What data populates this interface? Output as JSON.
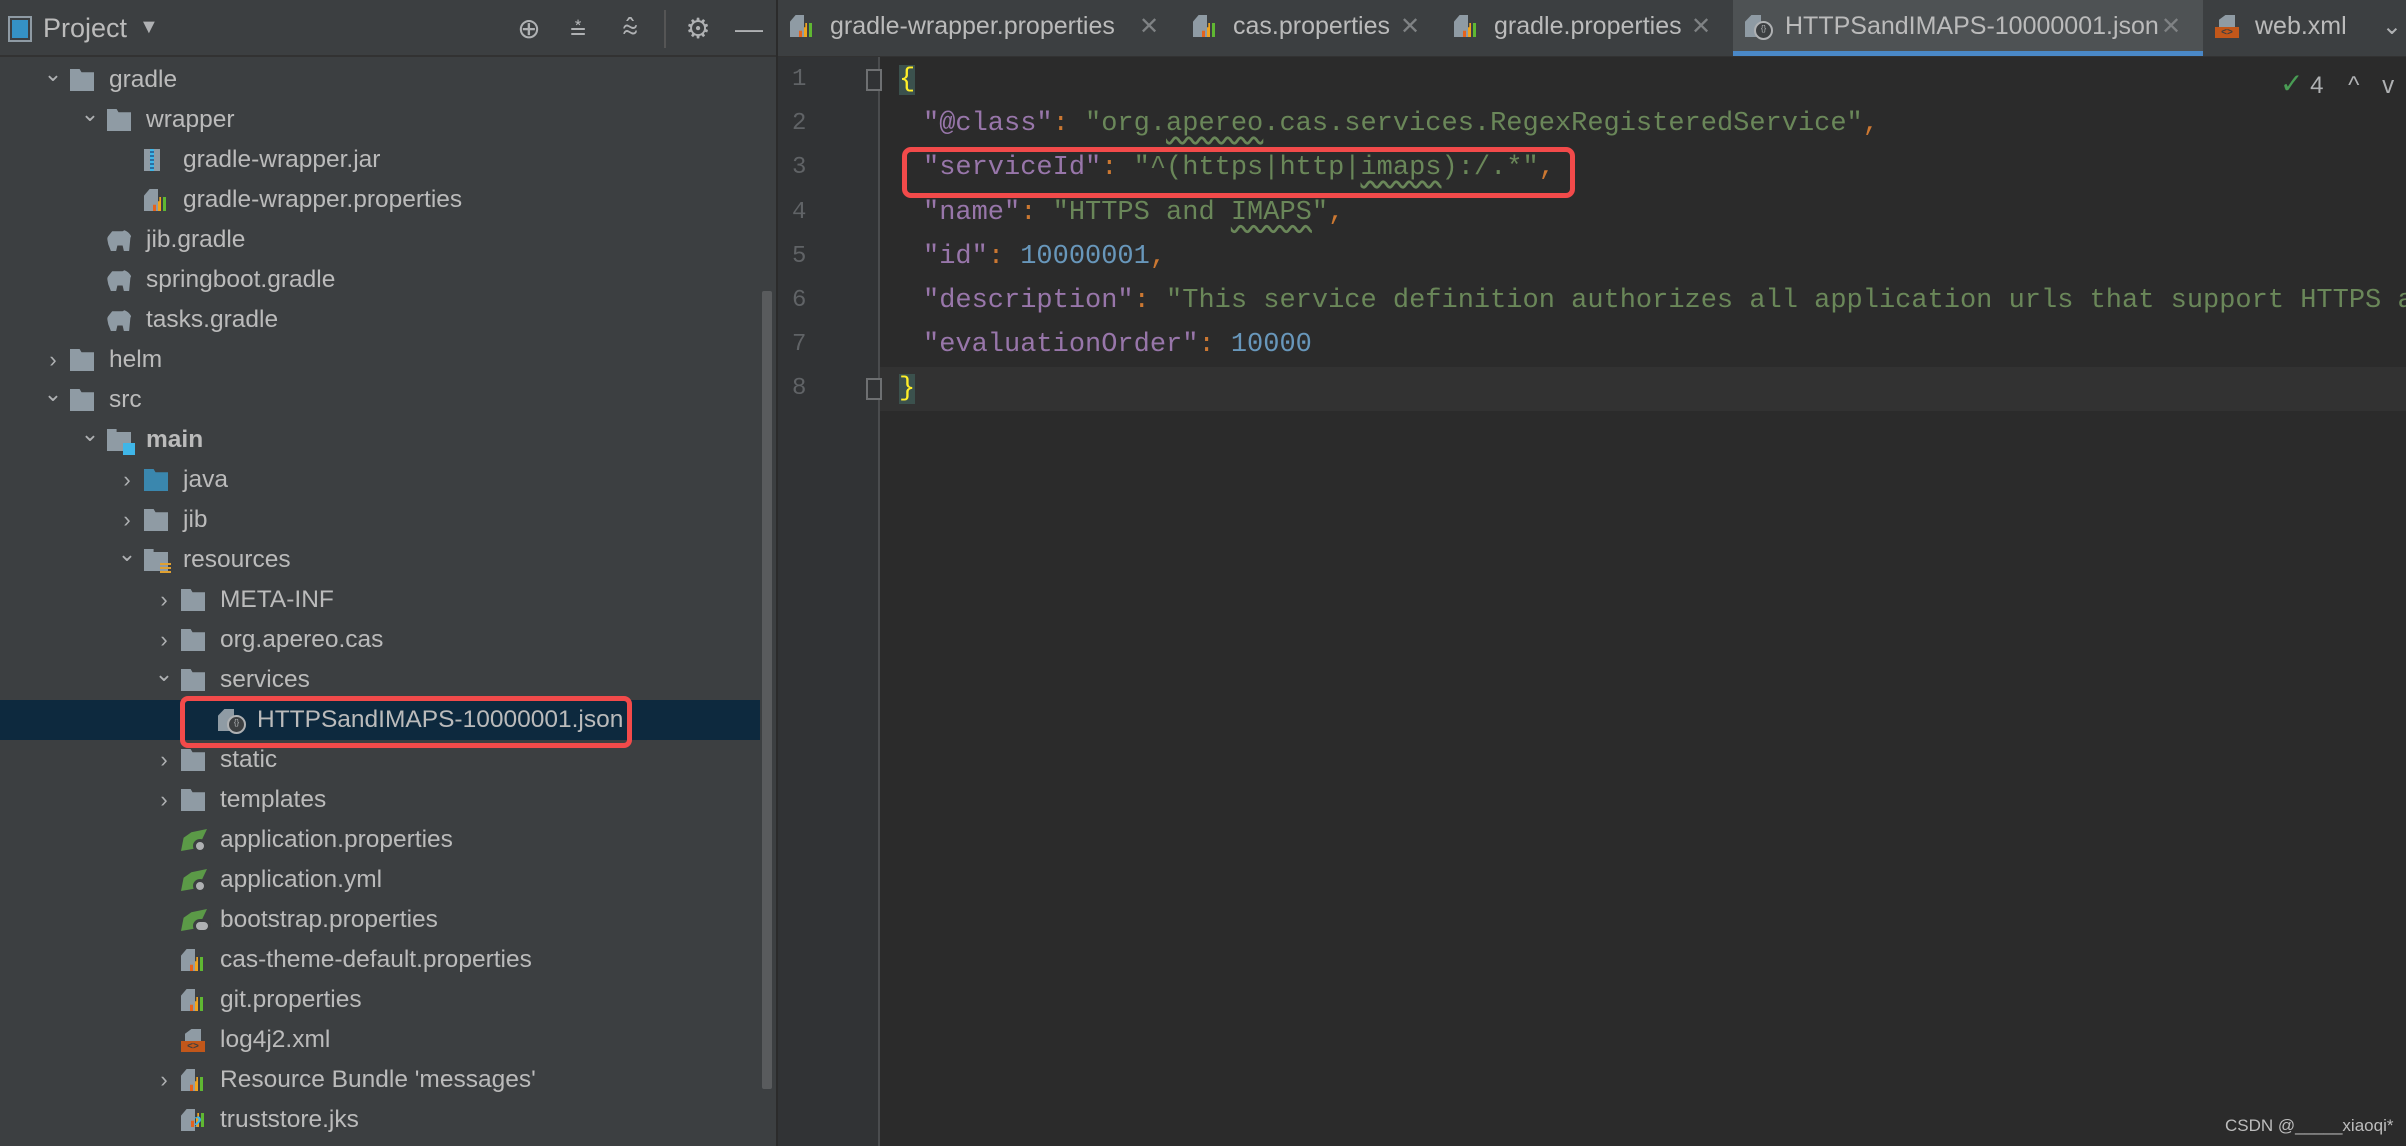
{
  "project_panel": {
    "title": "Project",
    "toolbar_icons": [
      "locate-icon",
      "expand-all-icon",
      "collapse-all-icon",
      "gear-icon",
      "minimize-icon"
    ],
    "tree": [
      {
        "label": "gradle",
        "level": 1,
        "kind": "folder",
        "expanded": true
      },
      {
        "label": "wrapper",
        "level": 2,
        "kind": "folder",
        "expanded": true
      },
      {
        "label": "gradle-wrapper.jar",
        "level": 3,
        "kind": "jar"
      },
      {
        "label": "gradle-wrapper.properties",
        "level": 3,
        "kind": "props"
      },
      {
        "label": "jib.gradle",
        "level": 2,
        "kind": "gradle"
      },
      {
        "label": "springboot.gradle",
        "level": 2,
        "kind": "gradle"
      },
      {
        "label": "tasks.gradle",
        "level": 2,
        "kind": "gradle"
      },
      {
        "label": "helm",
        "level": 1,
        "kind": "folder",
        "expanded": false
      },
      {
        "label": "src",
        "level": 1,
        "kind": "folder",
        "expanded": true
      },
      {
        "label": "main",
        "level": 2,
        "kind": "src-folder",
        "expanded": true,
        "bold": true
      },
      {
        "label": "java",
        "level": 3,
        "kind": "java-folder",
        "expanded": false
      },
      {
        "label": "jib",
        "level": 3,
        "kind": "folder",
        "expanded": false
      },
      {
        "label": "resources",
        "level": 3,
        "kind": "res-folder",
        "expanded": true
      },
      {
        "label": "META-INF",
        "level": 4,
        "kind": "folder",
        "expanded": false
      },
      {
        "label": "org.apereo.cas",
        "level": 4,
        "kind": "folder",
        "expanded": false
      },
      {
        "label": "services",
        "level": 4,
        "kind": "folder",
        "expanded": true
      },
      {
        "label": "HTTPSandIMAPS-10000001.json",
        "level": 5,
        "kind": "json",
        "selected": true,
        "highlighted": true
      },
      {
        "label": "static",
        "level": 4,
        "kind": "folder",
        "expanded": false
      },
      {
        "label": "templates",
        "level": 4,
        "kind": "folder",
        "expanded": false
      },
      {
        "label": "application.properties",
        "level": 4,
        "kind": "spring-gear"
      },
      {
        "label": "application.yml",
        "level": 4,
        "kind": "spring-gear"
      },
      {
        "label": "bootstrap.properties",
        "level": 4,
        "kind": "spring-cloud"
      },
      {
        "label": "cas-theme-default.properties",
        "level": 4,
        "kind": "props"
      },
      {
        "label": "git.properties",
        "level": 4,
        "kind": "props"
      },
      {
        "label": "log4j2.xml",
        "level": 4,
        "kind": "xml"
      },
      {
        "label": "Resource Bundle 'messages'",
        "level": 4,
        "kind": "props",
        "expanded": false
      },
      {
        "label": "truststore.jks",
        "level": 4,
        "kind": "jks"
      }
    ]
  },
  "tabs": [
    {
      "label": "gradle-wrapper.properties",
      "icon": "props",
      "closable": true
    },
    {
      "label": "cas.properties",
      "icon": "props",
      "closable": true
    },
    {
      "label": "gradle.properties",
      "icon": "props",
      "closable": true
    },
    {
      "label": "HTTPSandIMAPS-10000001.json",
      "icon": "json",
      "closable": true,
      "active": true
    },
    {
      "label": "web.xml",
      "icon": "xml",
      "closable": false
    }
  ],
  "editor": {
    "inspection": {
      "count": "4",
      "up": "^",
      "down": "v"
    },
    "current_line": 8,
    "highlighted_line": 3,
    "lines": [
      [
        {
          "t": "{",
          "c": "brace"
        }
      ],
      [
        {
          "t": "\"@class\"",
          "c": "key"
        },
        {
          "t": ": ",
          "c": "punc"
        },
        {
          "t": "\"org.",
          "c": "str"
        },
        {
          "t": "apereo",
          "c": "str warn"
        },
        {
          "t": ".cas.services.RegexRegisteredService\"",
          "c": "str"
        },
        {
          "t": ",",
          "c": "punc"
        }
      ],
      [
        {
          "t": "\"serviceId\"",
          "c": "key"
        },
        {
          "t": ": ",
          "c": "punc"
        },
        {
          "t": "\"^(https|http|",
          "c": "str"
        },
        {
          "t": "imaps",
          "c": "str warn"
        },
        {
          "t": "):/.*\"",
          "c": "str"
        },
        {
          "t": ",",
          "c": "punc"
        }
      ],
      [
        {
          "t": "\"name\"",
          "c": "key"
        },
        {
          "t": ": ",
          "c": "punc"
        },
        {
          "t": "\"HTTPS and ",
          "c": "str"
        },
        {
          "t": "IMAPS",
          "c": "str warn"
        },
        {
          "t": "\"",
          "c": "str"
        },
        {
          "t": ",",
          "c": "punc"
        }
      ],
      [
        {
          "t": "\"id\"",
          "c": "key"
        },
        {
          "t": ": ",
          "c": "punc"
        },
        {
          "t": "10000001",
          "c": "num"
        },
        {
          "t": ",",
          "c": "punc"
        }
      ],
      [
        {
          "t": "\"description\"",
          "c": "key"
        },
        {
          "t": ": ",
          "c": "punc"
        },
        {
          "t": "\"This service definition authorizes all application urls that support HTTPS an",
          "c": "str"
        }
      ],
      [
        {
          "t": "\"evaluationOrder\"",
          "c": "key"
        },
        {
          "t": ": ",
          "c": "punc"
        },
        {
          "t": "10000",
          "c": "num"
        }
      ],
      [
        {
          "t": "}",
          "c": "brace"
        }
      ]
    ]
  },
  "watermark": "CSDN @_____xiaoqi*",
  "colors": {
    "accent": "#4a88c7",
    "highlight_box": "#f24a4a",
    "selection": "#0d293e",
    "key": "#9876aa",
    "string": "#6a8759",
    "number": "#6897bb"
  }
}
